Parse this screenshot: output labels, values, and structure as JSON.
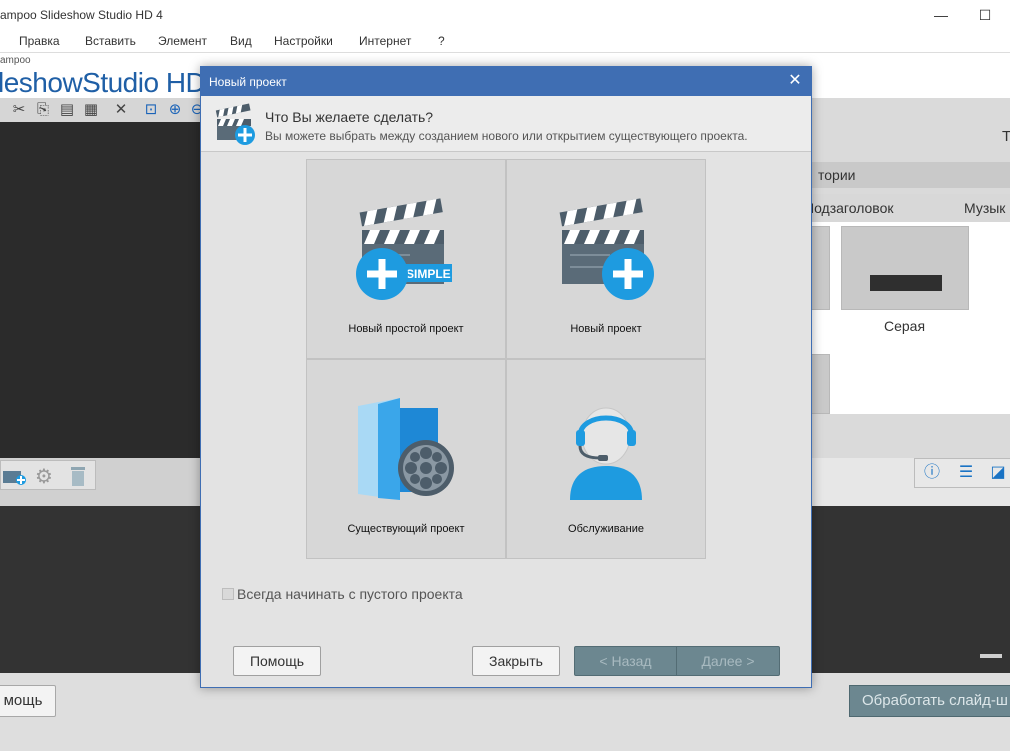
{
  "app": {
    "title": "ampoo Slideshow Studio HD 4",
    "brand_small": "ampoo",
    "brand_big": "leshowStudio HD",
    "minimize_symbol": "—",
    "maximize_symbol": "☐"
  },
  "menu": {
    "items": [
      "Правка",
      "Вставить",
      "Элемент",
      "Вид",
      "Настройки",
      "Интернет",
      "?"
    ]
  },
  "right_panel": {
    "partial_t": "T",
    "categories": "тории",
    "tab_subtitle": "Подзаголовок",
    "tab_music": "Музык",
    "thumb_label": "Серая"
  },
  "bottom": {
    "help_button": "мощь",
    "process_button": "Обработать слайд-ш"
  },
  "dialog": {
    "title": "Новый проект",
    "close_symbol": "✕",
    "question": "Что Вы желаете сделать?",
    "subtitle": "Вы можете выбрать между созданием нового или открытием существующего проекта.",
    "options": [
      {
        "label": "Новый простой проект",
        "badge": "SIMPLE"
      },
      {
        "label": "Новый проект"
      },
      {
        "label": "Существующий проект"
      },
      {
        "label": "Обслуживание"
      }
    ],
    "checkbox_label": "Всегда начинать с пустого проекта",
    "checkbox_checked": false,
    "buttons": {
      "help": "Помощь",
      "close": "Закрыть",
      "back": "< Назад",
      "next": "Далее >"
    }
  },
  "colors": {
    "dialog_title_bg": "#3f6eb3",
    "accent_blue": "#1e9be0",
    "disabled_button_bg": "#6c8790",
    "brand_blue": "#1f5fa6"
  },
  "icons": {
    "toolbar": [
      "scissors-icon",
      "copy-icon",
      "paste-icon",
      "layers-icon",
      "delete-icon",
      "zoom-fit-icon",
      "zoom-in-icon",
      "zoom-out-icon"
    ],
    "right_tools": [
      "info-icon",
      "align-icon",
      "edit-icon"
    ],
    "left_tools": [
      "add-image-icon",
      "settings-icon",
      "trash-icon"
    ]
  }
}
